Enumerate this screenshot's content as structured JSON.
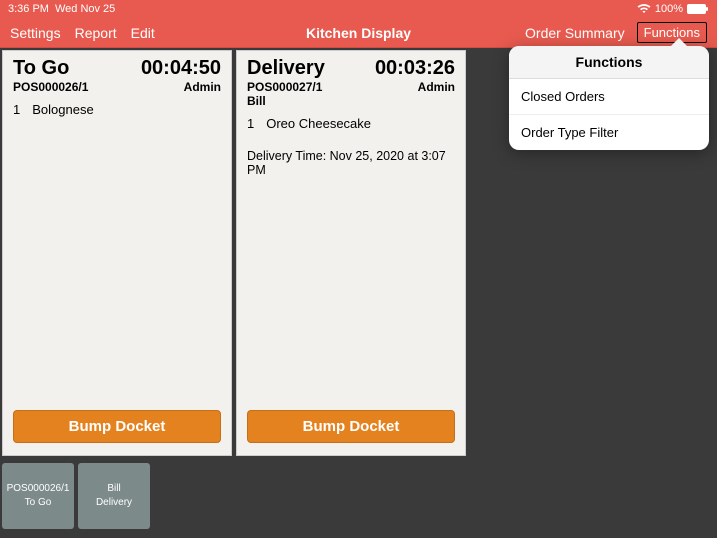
{
  "status": {
    "time": "3:36 PM",
    "date": "Wed Nov 25",
    "battery": "100%"
  },
  "nav": {
    "settings": "Settings",
    "report": "Report",
    "edit": "Edit",
    "title": "Kitchen Display",
    "order_summary": "Order Summary",
    "functions": "Functions"
  },
  "popover": {
    "title": "Functions",
    "item0": "Closed Orders",
    "item1": "Order Type Filter"
  },
  "dockets": [
    {
      "type": "To Go",
      "timer": "00:04:50",
      "order": "POS000026/1",
      "user": "Admin",
      "sub": "",
      "items": [
        {
          "qty": "1",
          "name": "Bolognese"
        }
      ],
      "delivery_time": "",
      "bump": "Bump Docket"
    },
    {
      "type": "Delivery",
      "timer": "00:03:26",
      "order": "POS000027/1",
      "user": "Admin",
      "sub": "Bill",
      "items": [
        {
          "qty": "1",
          "name": "Oreo Cheesecake"
        }
      ],
      "delivery_time": "Delivery Time: Nov 25, 2020 at 3:07 PM",
      "bump": "Bump Docket"
    }
  ],
  "tabs": [
    {
      "l1": "POS000026/1",
      "l2": "To Go"
    },
    {
      "l1": "Bill",
      "l2": "Delivery"
    }
  ]
}
